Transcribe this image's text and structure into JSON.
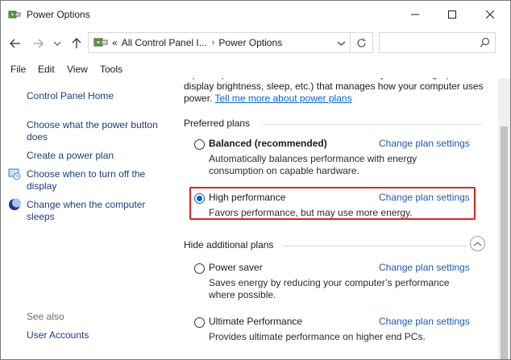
{
  "window": {
    "title": "Power Options"
  },
  "address": {
    "crumb_root": "«",
    "crumb_1": "All Control Panel I...",
    "crumb_2": "Power Options",
    "search_placeholder": ""
  },
  "menu": {
    "items": [
      "File",
      "Edit",
      "View",
      "Tools"
    ]
  },
  "sidebar": {
    "home": "Control Panel Home",
    "links": [
      "Choose what the power button does",
      "Create a power plan",
      "Choose when to turn off the display",
      "Change when the computer sleeps"
    ],
    "see_also_label": "See also",
    "see_also_links": [
      "User Accounts"
    ]
  },
  "main": {
    "intro_text": "A power plan is a collection of hardware and system settings (like display brightness, sleep, etc.) that manages how your computer uses power.",
    "intro_link": "Tell me more about power plans",
    "preferred_heading": "Preferred plans",
    "hidden_heading": "Hide additional plans",
    "change_label": "Change plan settings",
    "plans": [
      {
        "name": "Balanced (recommended)",
        "desc": "Automatically balances performance with energy consumption on capable hardware.",
        "selected": false
      },
      {
        "name": "High performance",
        "desc": "Favors performance, but may use more energy.",
        "selected": true
      },
      {
        "name": "Power saver",
        "desc": "Saves energy by reducing your computer’s performance where possible.",
        "selected": false
      },
      {
        "name": "Ultimate Performance",
        "desc": "Provides ultimate performance on higher end PCs.",
        "selected": false
      }
    ]
  },
  "colors": {
    "link": "#1e3c7a",
    "accent": "#0067c0",
    "highlight": "#e02020"
  }
}
